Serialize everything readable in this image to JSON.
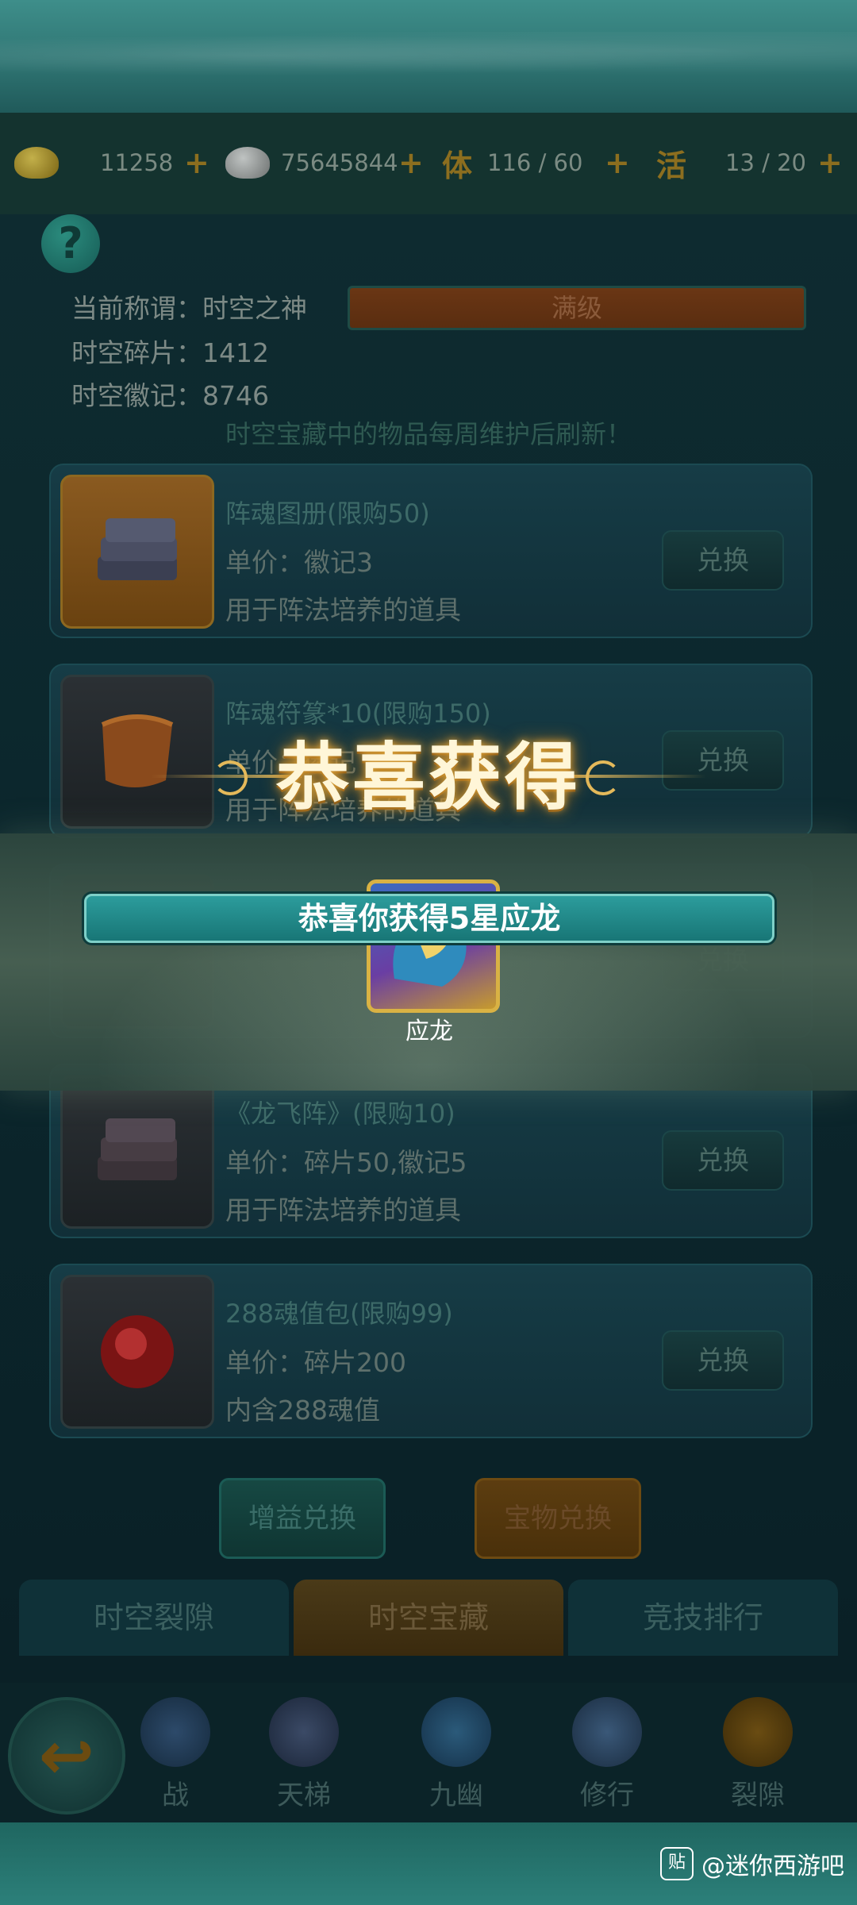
{
  "resources": [
    {
      "icon": "gold-ingot-icon",
      "value": "11258"
    },
    {
      "icon": "silver-ingot-icon",
      "value": "75645844"
    },
    {
      "icon": "stamina-icon",
      "glyph": "体",
      "value": "116 / 60"
    },
    {
      "icon": "activity-icon",
      "glyph": "活",
      "value": "13 / 20"
    }
  ],
  "info": {
    "title_label": "当前称谓：",
    "title_value": "时空之神",
    "title_bar": "满级",
    "fragments_label": "时空碎片：",
    "fragments_value": "1412",
    "emblems_label": "时空徽记：",
    "emblems_value": "8746",
    "refresh_note": "时空宝藏中的物品每周维护后刷新！"
  },
  "shop_items": [
    {
      "name": "阵魂图册(限购50)",
      "price": "单价：徽记3",
      "desc": "用于阵法培养的道具",
      "button": "兑换",
      "icon": "book-stack-icon"
    },
    {
      "name": "阵魂符篆*10(限购150)",
      "price": "单价：徽记",
      "desc": "用于阵法培养的道具",
      "button": "兑换",
      "icon": "scroll-icon"
    },
    {
      "name": "",
      "price": "",
      "desc": "",
      "button": "兑换",
      "icon": "hidden-item-icon"
    },
    {
      "name": "《龙飞阵》(限购10)",
      "price": "单价：碎片50,徽记5",
      "desc": "用于阵法培养的道具",
      "button": "兑换",
      "icon": "book-stack-icon"
    },
    {
      "name": "288魂值包(限购99)",
      "price": "单价：碎片200",
      "desc": "内含288魂值",
      "button": "兑换",
      "icon": "red-orb-icon"
    }
  ],
  "sub_buttons": {
    "gain": "增益兑换",
    "treasure": "宝物兑换"
  },
  "tabs": [
    {
      "label": "时空裂隙",
      "active": false
    },
    {
      "label": "时空宝藏",
      "active": true
    },
    {
      "label": "竞技排行",
      "active": false
    }
  ],
  "bottom_nav": [
    {
      "label": "战",
      "icon": "battle-icon"
    },
    {
      "label": "天梯",
      "icon": "ladder-icon"
    },
    {
      "label": "九幽",
      "icon": "nether-icon"
    },
    {
      "label": "修行",
      "icon": "cultivation-icon"
    },
    {
      "label": "裂隙",
      "icon": "rift-icon"
    }
  ],
  "reward": {
    "title": "恭喜获得",
    "message": "恭喜你获得5星应龙",
    "item_name": "应龙"
  },
  "watermark": {
    "logo": "贴",
    "text": "@迷你西游吧"
  },
  "colors": {
    "gold_text": "#fff6d8",
    "banner_teal": "#1f8585",
    "accent_orange": "#6a3614"
  }
}
